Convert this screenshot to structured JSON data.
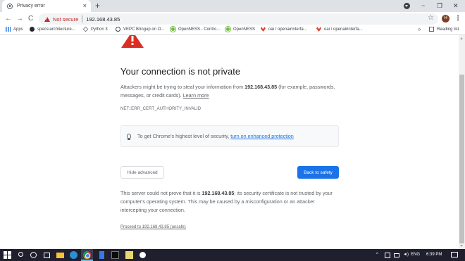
{
  "tab": {
    "title": "Privacy error",
    "close": "×"
  },
  "newtab": "+",
  "window_controls": {
    "minimize": "−",
    "maximize": "❐",
    "close": "✕"
  },
  "toolbar": {
    "back": "←",
    "forward": "→",
    "reload": "C",
    "security_text": "Not secure",
    "url": "192.168.43.85",
    "profile_initial": "H",
    "menu": "⋮",
    "star": "☆"
  },
  "bookmarks": {
    "items": [
      {
        "label": "Apps",
        "icon": "apps-grid-icon"
      },
      {
        "label": "specs/architecture...",
        "icon": "github-icon"
      },
      {
        "label": "Python 3",
        "icon": "python-icon"
      },
      {
        "label": "VEPC Bringup on O...",
        "icon": "globe-icon"
      },
      {
        "label": "OpenNESS - Contro...",
        "icon": "openness-icon"
      },
      {
        "label": "OpenNESS",
        "icon": "openness-icon"
      },
      {
        "label": "oai / openairinterfa...",
        "icon": "gitlab-icon"
      },
      {
        "label": "oai / openairinterfa...",
        "icon": "gitlab-icon"
      }
    ],
    "more": "»",
    "reading_list": "Reading list"
  },
  "interstitial": {
    "heading": "Your connection is not private",
    "p1_before": "Attackers might be trying to steal your information from ",
    "p1_host": "192.168.43.85",
    "p1_after": " (for example, passwords, messages, or credit cards). ",
    "learn_more": "Learn more",
    "error_code": "NET::ERR_CERT_AUTHORITY_INVALID",
    "protection_text": "To get Chrome's highest level of security, ",
    "protection_link": "turn on enhanced protection",
    "hide_advanced": "Hide advanced",
    "back_to_safety": "Back to safety",
    "p2_before": "This server could not prove that it is ",
    "p2_host": "192.168.43.85",
    "p2_after": "; its security certificate is not trusted by your computer's operating system. This may be caused by a misconfiguration or an attacker intercepting your connection.",
    "proceed": "Proceed to 192.168.43.85 (unsafe)"
  },
  "taskbar": {
    "language": "ENG",
    "time": "6:39 PM",
    "tray_chevron": "^"
  },
  "colors": {
    "warning_red": "#c5221f",
    "link_blue": "#1a73e8",
    "button_blue": "#1a73e8"
  }
}
